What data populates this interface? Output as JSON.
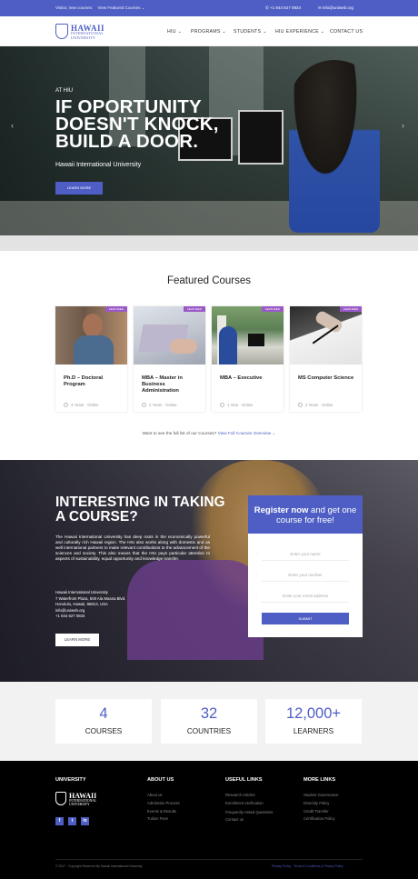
{
  "topbar": {
    "visitor_text": "Visitor, new courses:",
    "visitor_link": "View Featured Courses",
    "phone": "+1 844 627 0834",
    "email": "info@uniweb.org"
  },
  "brand": {
    "name": "HAWAII",
    "sub": "INTERNATIONAL UNIVERSITY"
  },
  "nav": {
    "items": [
      "HIU",
      "PROGRAMS",
      "STUDENTS",
      "HIU EXPERIENCE",
      "CONTACT US"
    ]
  },
  "hero": {
    "eyebrow": "AT HIU",
    "headline": "IF OPORTUNITY DOESN'T KNOCK, BUILD A DOOR.",
    "subtitle": "Hawaii International University",
    "button": "LEARN MORE"
  },
  "featured": {
    "title": "Featured Courses",
    "cards": [
      {
        "tag": "FEATURED",
        "title": "Ph.D – Doctoral Program",
        "meta": "4 Years · Online"
      },
      {
        "tag": "FEATURED",
        "title": "MBA – Master in Business Administration",
        "meta": "2 Years · Online"
      },
      {
        "tag": "FEATURED",
        "title": "MBA – Executive",
        "meta": "1 Year · Online"
      },
      {
        "tag": "FEATURED",
        "title": "MS Computer Science",
        "meta": "2 Years · Online"
      }
    ],
    "more_text": "Want to see the full list of our Courses?",
    "more_link": "View Full Courses Overview"
  },
  "course": {
    "title": "INTERESTING IN TAKING A COURSE?",
    "paragraph": "The Hawaii International University has deep roots in the economically powerful and culturally rich Hawaii region. The HIU also works along with domestic and as well international partners to make relevant contributions to the advancement of the sciences and society. This also means that the HIU pays particular attention to aspects of sustainability, equal opportunity and knowledge transfer.",
    "address": [
      "Hawaii International University",
      "7 Waterfront Plaza, 500 Ala Moana Blvd.",
      "Honolulu, Hawaii, 96813, USA",
      "info@uniweb.org",
      "+1 844 627 0834"
    ],
    "button": "LEARN MORE"
  },
  "register": {
    "title_bold": "Register now",
    "title_rest": "and get one course for free!",
    "name_placeholder": "Enter your name",
    "phone_placeholder": "Enter your number",
    "email_placeholder": "Enter your email address",
    "submit": "SUBMIT"
  },
  "stats": [
    {
      "number": "4",
      "label": "COURSES"
    },
    {
      "number": "32",
      "label": "COUNTRIES"
    },
    {
      "number": "12,000+",
      "label": "LEARNERS"
    }
  ],
  "footer": {
    "col1": "UNIVERSITY",
    "col2": "ABOUT US",
    "col3": "USEFUL LINKS",
    "col4": "MORE LINKS",
    "about_links": [
      "About us",
      "Admission Process",
      "Events & Results",
      "Tuition Fees"
    ],
    "useful_links": [
      "Research Articles",
      "Enrollment Verification",
      "Frequently Asked Questions",
      "Contact us"
    ],
    "more_links": [
      "Student Governance",
      "Diversity Policy",
      "Credit Transfer",
      "Certification Policy"
    ],
    "social": [
      "f",
      "t",
      "in"
    ],
    "copyright": "© 2017 · Copyright Reserved By Hawaii International University",
    "legal": "Privacy Policy · Terms & Conditions & Privacy Policy"
  },
  "colors": {
    "accent": "#4e5ec4",
    "tag": "#9b58c7"
  }
}
